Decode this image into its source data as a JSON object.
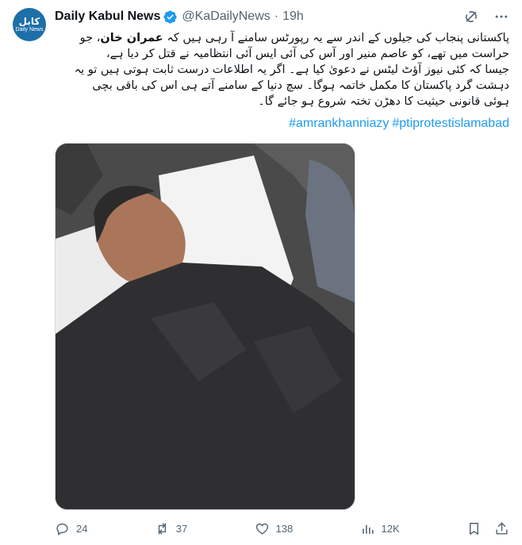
{
  "tweet": {
    "avatar_top": "کابل",
    "avatar_bottom": "Daily News",
    "name": "Daily Kabul News",
    "handle": "@KaDailyNews",
    "separator": "·",
    "time": "19h",
    "text_line1_a": "پاکستانی پنجاب کی جیلوں کے اندر سے یہ رپورٹس سامنے آ رہی ہیں کہ ",
    "text_line1_bold": "عمران خان",
    "text_line1_b": "، جو",
    "text_line2": "حراست میں تھے، کو عاصم منیر اور آس کی آئی ایس آئی انتظامیہ نے قتل کر دیا ہے،",
    "text_line3": "جیسا کہ کئی نیوز آؤٹ لیٹس نے دعویٰ کیا ہے۔ اگر یہ اطلاعات درست ثابت ہوتی ہیں تو یہ",
    "text_line4": "دہشت گرد پاکستان کا مکمل خاتمہ ہوگا۔ سچ دنیا کے سامنے آتے ہی اس کی باقی بچی",
    "text_line5": "ہوئی قانونی حیثیت کا دھڑن تختہ شروع ہو جائے گا۔",
    "hashtags": [
      "#amrankhanniazy",
      "#ptiprotestislamabad"
    ],
    "replies": "24",
    "retweets": "37",
    "likes": "138",
    "views": "12K"
  },
  "icons": {
    "verified": "verified-badge-icon",
    "grok": "grok-icon",
    "more": "more-icon",
    "reply": "reply-icon",
    "retweet": "retweet-icon",
    "like": "heart-icon",
    "views": "views-icon",
    "bookmark": "bookmark-icon",
    "share": "share-icon"
  },
  "colors": {
    "link": "#1d9bf0",
    "muted": "#536471",
    "verified": "#1d9bf0",
    "avatar": "#1d6fa8"
  }
}
